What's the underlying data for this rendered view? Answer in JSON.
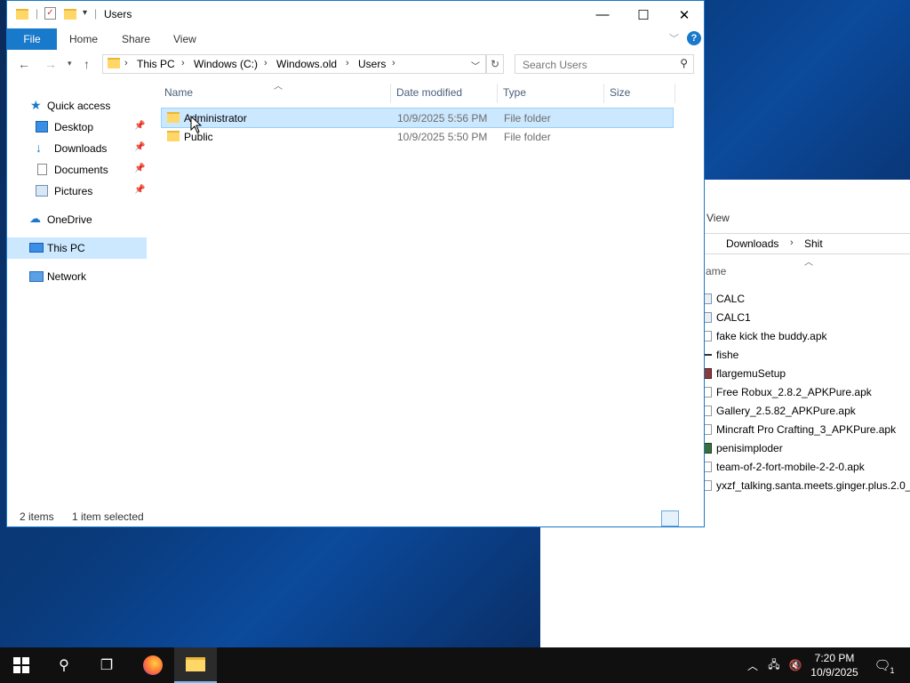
{
  "window": {
    "title": "Users",
    "minimize_glyph": "—",
    "maximize_glyph": "☐",
    "close_glyph": "✕",
    "accent": "#1979ca"
  },
  "ribbon": {
    "file": "File",
    "tabs": [
      "Home",
      "Share",
      "View"
    ]
  },
  "address": {
    "segments": [
      "This PC",
      "Windows (C:)",
      "Windows.old",
      "Users"
    ]
  },
  "search": {
    "placeholder": "Search Users"
  },
  "nav": {
    "items": [
      {
        "label": "Quick access",
        "icon": "star-icon"
      },
      {
        "label": "Desktop",
        "icon": "desktop-icon",
        "pinned": true
      },
      {
        "label": "Downloads",
        "icon": "download-icon",
        "pinned": true
      },
      {
        "label": "Documents",
        "icon": "documents-icon",
        "pinned": true
      },
      {
        "label": "Pictures",
        "icon": "pictures-icon",
        "pinned": true
      },
      {
        "label": "OneDrive",
        "icon": "cloud-icon"
      },
      {
        "label": "This PC",
        "icon": "computer-icon"
      },
      {
        "label": "Network",
        "icon": "network-icon"
      }
    ]
  },
  "columns": {
    "name": "Name",
    "date": "Date modified",
    "type": "Type",
    "size": "Size"
  },
  "files": [
    {
      "name": "Administrator",
      "date": "10/9/2025 5:56 PM",
      "type": "File folder",
      "selected": true
    },
    {
      "name": "Public",
      "date": "10/9/2025 5:50 PM",
      "type": "File folder",
      "selected": false
    }
  ],
  "status": {
    "count": "2 items",
    "selection": "1 item selected"
  },
  "background_window": {
    "tab": "View",
    "path": [
      "Downloads",
      "Shit"
    ],
    "column": "ame",
    "files": [
      "CALC",
      "CALC1",
      "fake kick the buddy.apk",
      "fishe",
      "flargemuSetup",
      "Free Robux_2.8.2_APKPure.apk",
      "Gallery_2.5.82_APKPure.apk",
      "Mincraft Pro Crafting_3_APKPure.apk",
      "penisimploder",
      "team-of-2-fort-mobile-2-2-0.apk",
      "yxzf_talking.santa.meets.ginger.plus.2.0_..."
    ]
  },
  "taskbar": {
    "time": "7:20 PM",
    "date": "10/9/2025",
    "notification_count": "1"
  }
}
